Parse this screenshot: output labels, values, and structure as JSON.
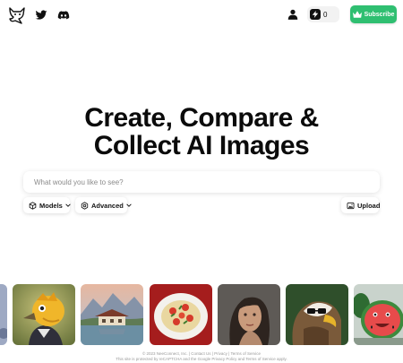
{
  "header": {
    "logo_icon": "fox-logo-icon",
    "social": [
      "twitter-icon",
      "discord-icon"
    ],
    "user_icon": "user-icon",
    "credits": {
      "icon": "bolt-icon",
      "count": "0"
    },
    "subscribe": {
      "icon": "crown-icon",
      "label": "Subscribe",
      "color": "#2fbf71"
    }
  },
  "hero": {
    "line1": "Create, Compare &",
    "line2": "Collect AI Images"
  },
  "search": {
    "placeholder": "What would you like to see?",
    "value": ""
  },
  "controls": {
    "models_label": "Models",
    "advanced_label": "Advanced",
    "upload_label": "Upload"
  },
  "gallery": {
    "items": [
      "partial-image",
      "yellow-bird-in-jacket",
      "mountain-lake-house",
      "pasta-dish-with-tomatoes",
      "woman-portrait",
      "eagle-with-glasses",
      "watermelon-character"
    ]
  },
  "footer": {
    "line1": "© 2023 NeeConnect, Inc. | Contact Us | Privacy | Terms of Service",
    "line2": "This site is protected by reCAPTCHA and the Google Privacy Policy and Terms of Service apply."
  }
}
